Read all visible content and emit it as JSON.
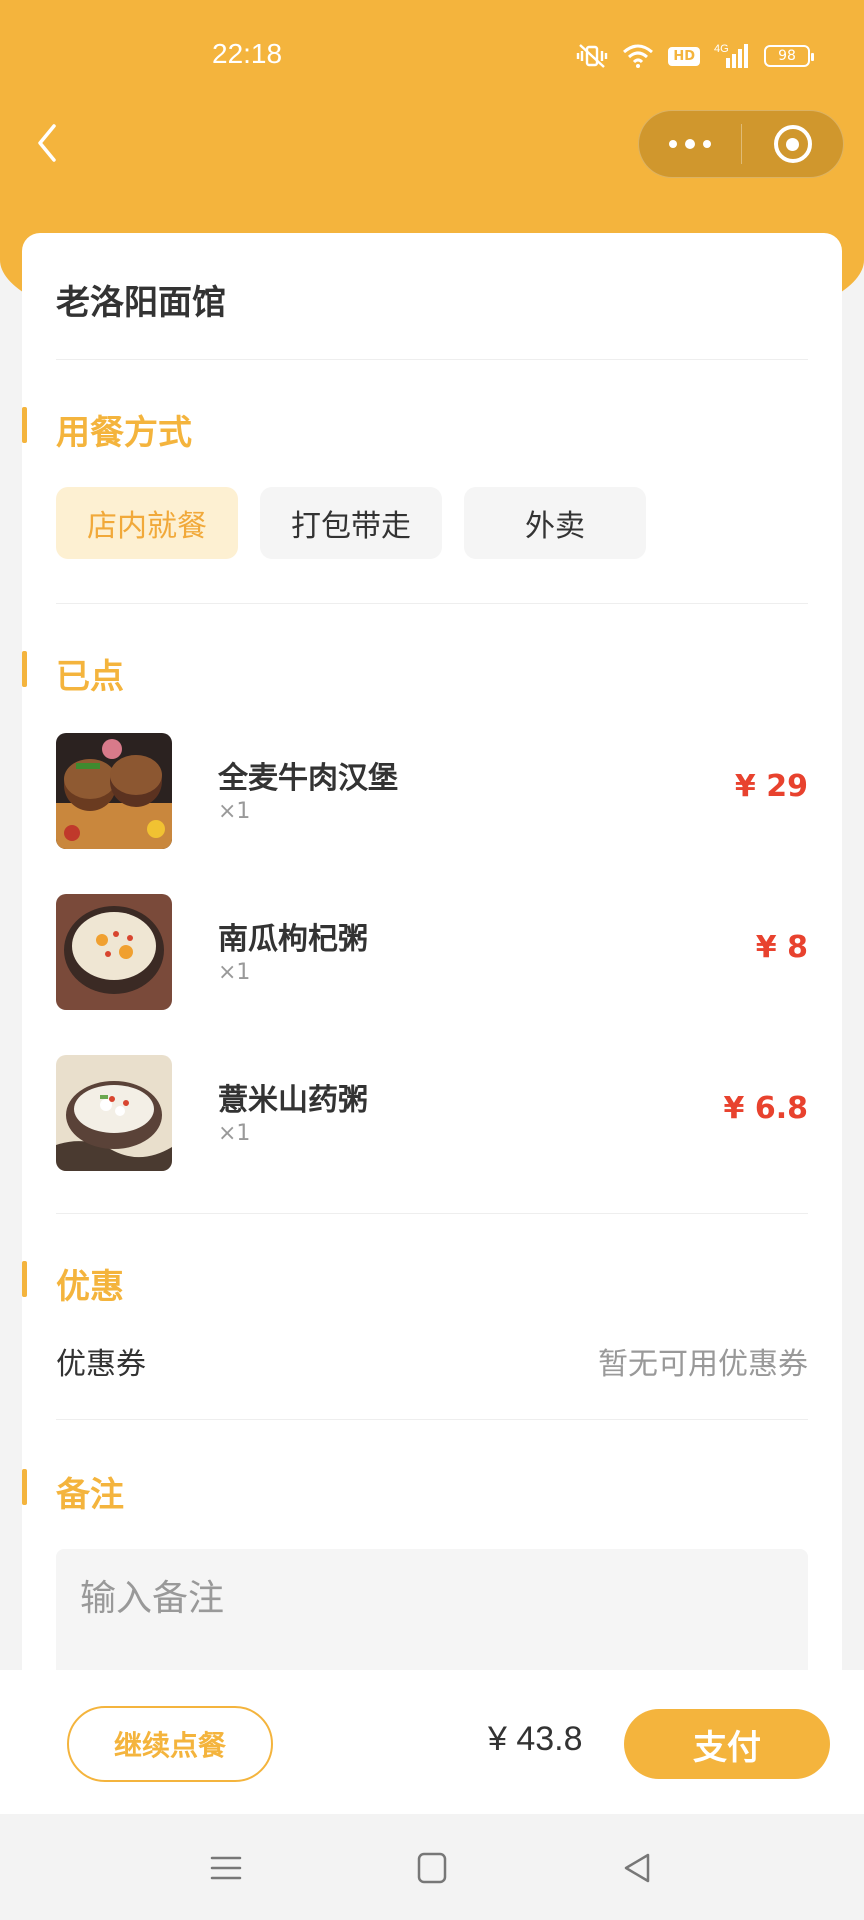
{
  "status_bar": {
    "time": "22:18",
    "network": "4G",
    "hd": "HD",
    "battery": "98"
  },
  "colors": {
    "accent": "#f4b43d",
    "price": "#e8422e",
    "active_bg": "#fdf0d2"
  },
  "header": {
    "back_icon": "chevron-left-icon",
    "more_icon": "more-dots-icon",
    "close_icon": "target-icon"
  },
  "shop": {
    "name": "老洛阳面馆"
  },
  "dining": {
    "title": "用餐方式",
    "options": [
      "店内就餐",
      "打包带走",
      "外卖"
    ],
    "selected": "店内就餐"
  },
  "ordered": {
    "title": "已点",
    "items": [
      {
        "name": "全麦牛肉汉堡",
        "qty": "×1",
        "price": "¥ 29"
      },
      {
        "name": "南瓜枸杞粥",
        "qty": "×1",
        "price": "¥ 8"
      },
      {
        "name": "薏米山药粥",
        "qty": "×1",
        "price": "¥ 6.8"
      }
    ]
  },
  "discount": {
    "title": "优惠",
    "coupon_label": "优惠券",
    "coupon_value": "暂无可用优惠券"
  },
  "remark": {
    "title": "备注",
    "placeholder": "输入备注"
  },
  "bottom": {
    "continue_label": "继续点餐",
    "total": "¥ 43.8",
    "pay_label": "支付"
  }
}
